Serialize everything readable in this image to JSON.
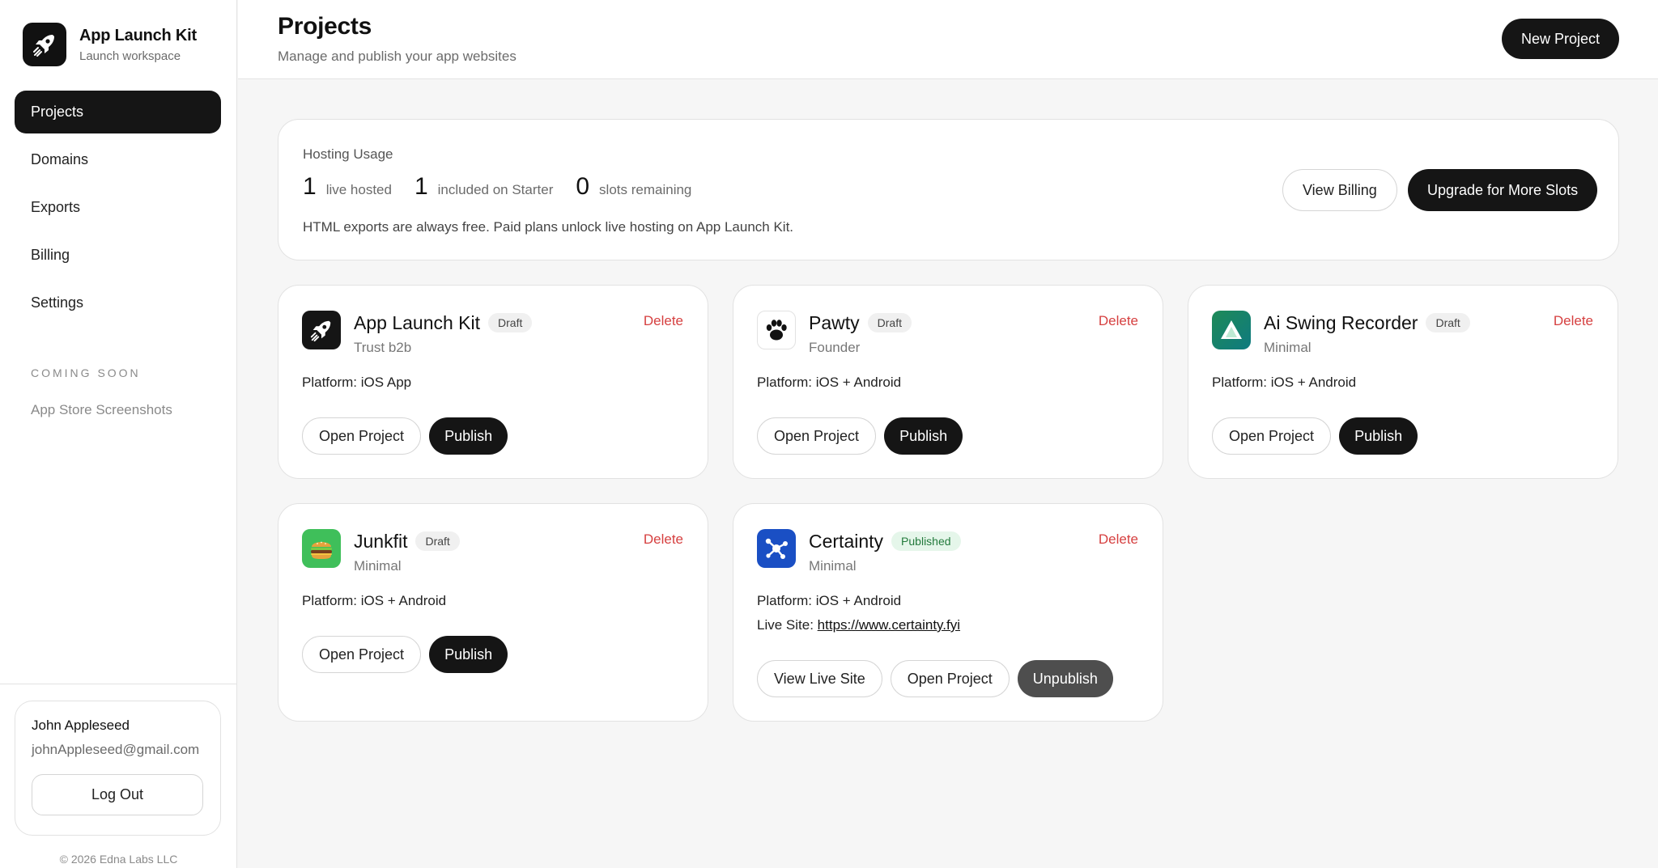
{
  "brand": {
    "title": "App Launch Kit",
    "subtitle": "Launch workspace",
    "logo_icon": "rocket-icon"
  },
  "nav": {
    "items": [
      {
        "label": "Projects",
        "active": true
      },
      {
        "label": "Domains",
        "active": false
      },
      {
        "label": "Exports",
        "active": false
      },
      {
        "label": "Billing",
        "active": false
      },
      {
        "label": "Settings",
        "active": false
      }
    ],
    "coming_soon_label": "COMING SOON",
    "coming_soon_items": [
      "App Store Screenshots"
    ]
  },
  "user": {
    "name": "John Appleseed",
    "email": "johnAppleseed@gmail.com",
    "logout_label": "Log Out"
  },
  "footer": {
    "copyright": "© 2026 Edna Labs LLC"
  },
  "header": {
    "title": "Projects",
    "subtitle": "Manage and publish your app websites",
    "new_project_label": "New Project"
  },
  "usage": {
    "heading": "Hosting Usage",
    "live_hosted": {
      "value": "1",
      "label": "live hosted"
    },
    "included": {
      "value": "1",
      "label": "included on Starter"
    },
    "remaining": {
      "value": "0",
      "label": "slots remaining"
    },
    "note": "HTML exports are always free. Paid plans unlock live hosting on App Launch Kit.",
    "view_billing_label": "View Billing",
    "upgrade_label": "Upgrade for More Slots"
  },
  "projects": [
    {
      "name": "App Launch Kit",
      "status": "Draft",
      "subtitle": "Trust b2b",
      "platform": "Platform: iOS App",
      "delete_label": "Delete",
      "open_label": "Open Project",
      "publish_label": "Publish",
      "icon": "rocket-icon"
    },
    {
      "name": "Pawty",
      "status": "Draft",
      "subtitle": "Founder",
      "platform": "Platform: iOS + Android",
      "delete_label": "Delete",
      "open_label": "Open Project",
      "publish_label": "Publish",
      "icon": "paw-icon"
    },
    {
      "name": "Ai Swing Recorder",
      "status": "Draft",
      "subtitle": "Minimal",
      "platform": "Platform: iOS + Android",
      "delete_label": "Delete",
      "open_label": "Open Project",
      "publish_label": "Publish",
      "icon": "triangle-icon"
    },
    {
      "name": "Junkfit",
      "status": "Draft",
      "subtitle": "Minimal",
      "platform": "Platform: iOS + Android",
      "delete_label": "Delete",
      "open_label": "Open Project",
      "publish_label": "Publish",
      "icon": "burger-icon"
    },
    {
      "name": "Certainty",
      "status": "Published",
      "subtitle": "Minimal",
      "platform": "Platform: iOS + Android",
      "live_site_label": "Live Site:",
      "live_site_url": "https://www.certainty.fyi",
      "delete_label": "Delete",
      "view_live_label": "View Live Site",
      "open_label": "Open Project",
      "unpublish_label": "Unpublish",
      "icon": "network-icon"
    }
  ],
  "colors": {
    "primary": "#151515",
    "danger": "#d64040",
    "published_bg": "#e5f6ea",
    "published_text": "#237a3c",
    "unpublish": "#4e4e4e"
  }
}
